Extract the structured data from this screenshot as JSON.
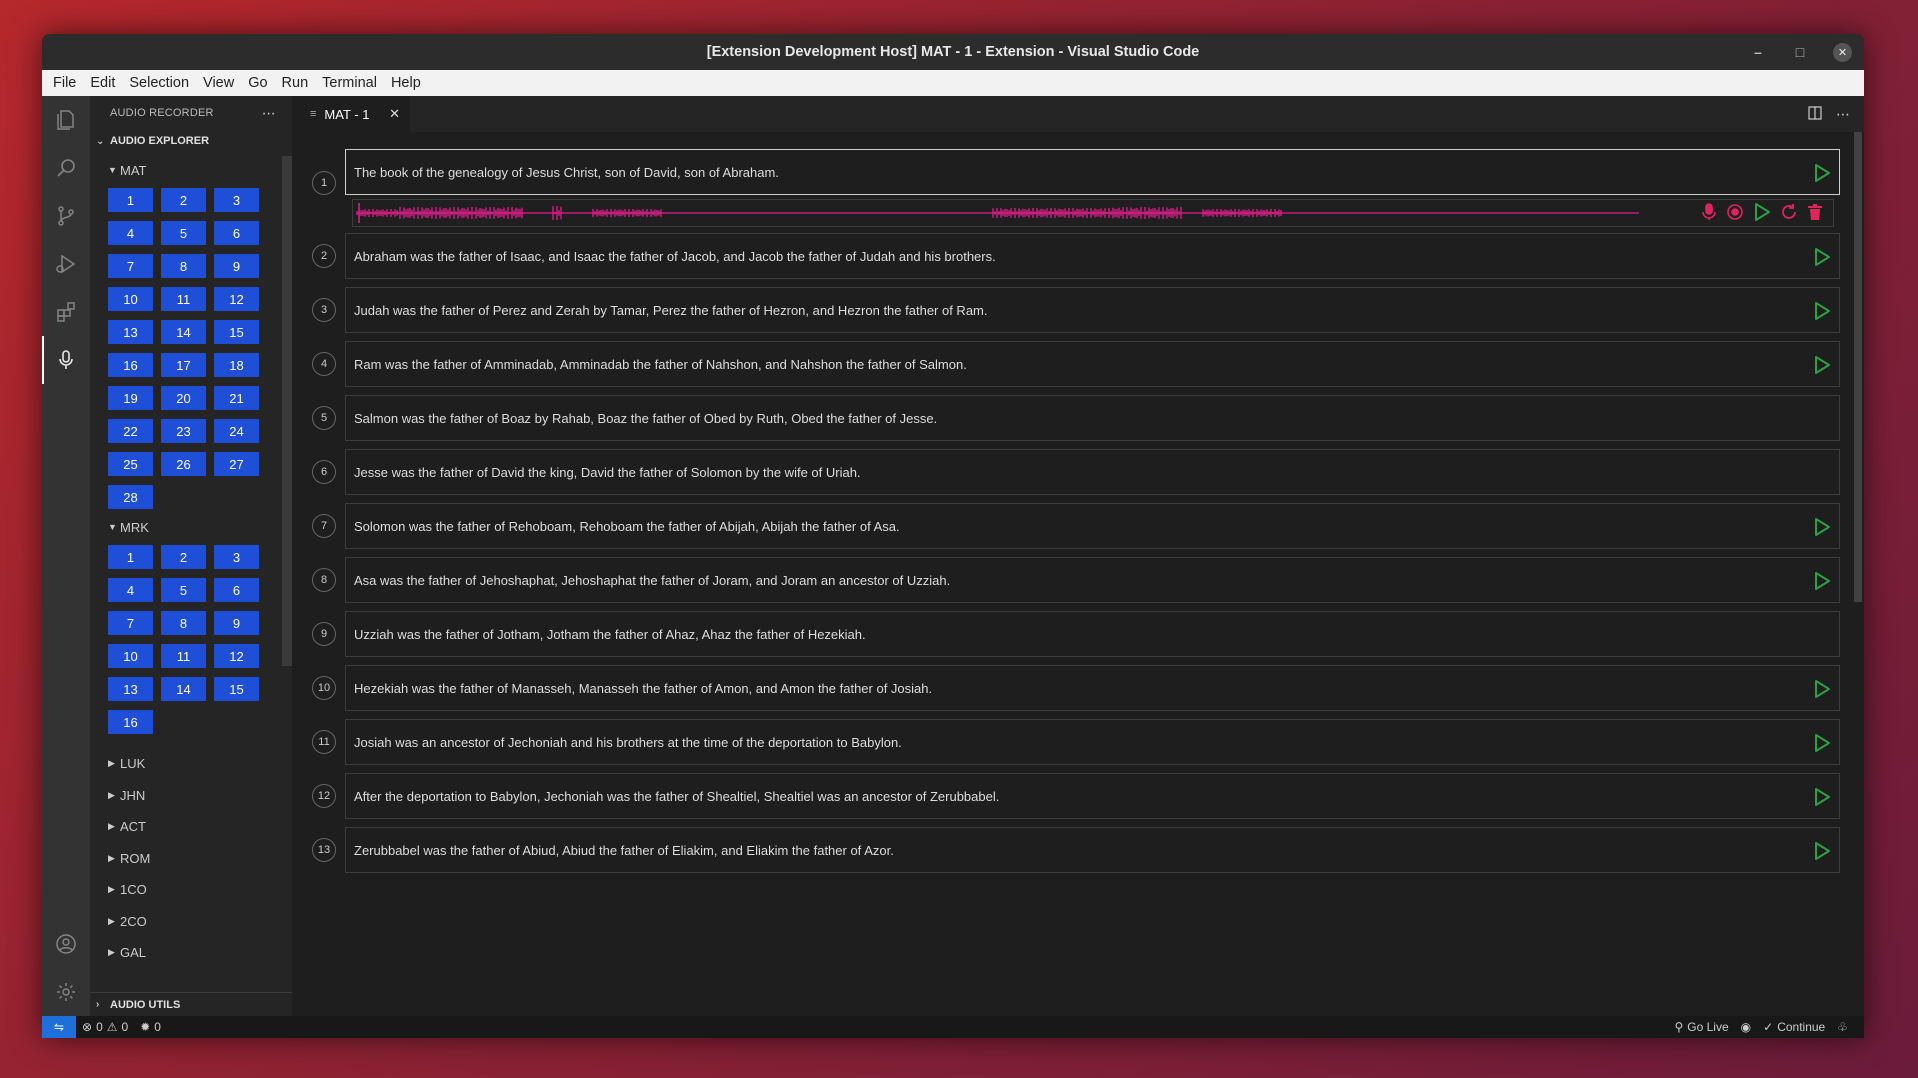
{
  "window": {
    "title": "[Extension Development Host] MAT - 1 - Extension - Visual Studio Code"
  },
  "menu": [
    "File",
    "Edit",
    "Selection",
    "View",
    "Go",
    "Run",
    "Terminal",
    "Help"
  ],
  "sidebar": {
    "title": "AUDIO RECORDER",
    "section": "AUDIO EXPLORER",
    "books": [
      {
        "name": "MAT",
        "expanded": true,
        "chapters": [
          "1",
          "2",
          "3",
          "4",
          "5",
          "6",
          "7",
          "8",
          "9",
          "10",
          "11",
          "12",
          "13",
          "14",
          "15",
          "16",
          "17",
          "18",
          "19",
          "20",
          "21",
          "22",
          "23",
          "24",
          "25",
          "26",
          "27",
          "28"
        ]
      },
      {
        "name": "MRK",
        "expanded": true,
        "chapters": [
          "1",
          "2",
          "3",
          "4",
          "5",
          "6",
          "7",
          "8",
          "9",
          "10",
          "11",
          "12",
          "13",
          "14",
          "15",
          "16"
        ]
      }
    ],
    "collapsed_books": [
      "LUK",
      "JHN",
      "ACT",
      "ROM",
      "1CO",
      "2CO",
      "GAL"
    ],
    "footer_section": "AUDIO UTILS"
  },
  "editor": {
    "tab_label": "MAT - 1",
    "verses": [
      {
        "num": "1",
        "text": "The book of the genealogy of Jesus Christ, son of David, son of Abraham.",
        "has_audio": true,
        "selected": true
      },
      {
        "num": "2",
        "text": "Abraham was the father of Isaac, and Isaac the father of Jacob, and Jacob the father of Judah and his brothers.",
        "has_audio": true
      },
      {
        "num": "3",
        "text": "Judah was the father of Perez and Zerah by Tamar, Perez the father of Hezron, and Hezron the father of Ram.",
        "has_audio": true
      },
      {
        "num": "4",
        "text": "Ram was the father of Amminadab, Amminadab the father of Nahshon, and Nahshon the father of Salmon.",
        "has_audio": true
      },
      {
        "num": "5",
        "text": "Salmon was the father of Boaz by Rahab, Boaz the father of Obed by Ruth, Obed the father of Jesse.",
        "has_audio": false
      },
      {
        "num": "6",
        "text": "Jesse was the father of David the king, David the father of Solomon by the wife of Uriah.",
        "has_audio": false
      },
      {
        "num": "7",
        "text": "Solomon was the father of Rehoboam, Rehoboam the father of Abijah, Abijah the father of Asa.",
        "has_audio": true
      },
      {
        "num": "8",
        "text": "Asa was the father of Jehoshaphat, Jehoshaphat the father of Joram, and Joram an ancestor of Uzziah.",
        "has_audio": true
      },
      {
        "num": "9",
        "text": "Uzziah was the father of Jotham, Jotham the father of Ahaz, Ahaz the father of Hezekiah.",
        "has_audio": false
      },
      {
        "num": "10",
        "text": "Hezekiah was the father of Manasseh, Manasseh the father of Amon, and Amon the father of Josiah.",
        "has_audio": true
      },
      {
        "num": "11",
        "text": "Josiah was an ancestor of Jechoniah and his brothers at the time of the deportation to Babylon.",
        "has_audio": true
      },
      {
        "num": "12",
        "text": "After the deportation to Babylon, Jechoniah was the father of Shealtiel, Shealtiel was an ancestor of Zerubbabel.",
        "has_audio": true
      },
      {
        "num": "13",
        "text": "Zerubbabel was the father of Abiud, Abiud the father of Eliakim, and Eliakim the father of Azor.",
        "has_audio": true
      }
    ]
  },
  "status": {
    "errors": "0",
    "warnings": "0",
    "ports": "0",
    "go_live": "Go Live",
    "continue": "Continue"
  },
  "colors": {
    "accent": "#1e4fd6",
    "play": "#2ea043",
    "waveform": "#e01e8c",
    "record": "#e0245e"
  }
}
